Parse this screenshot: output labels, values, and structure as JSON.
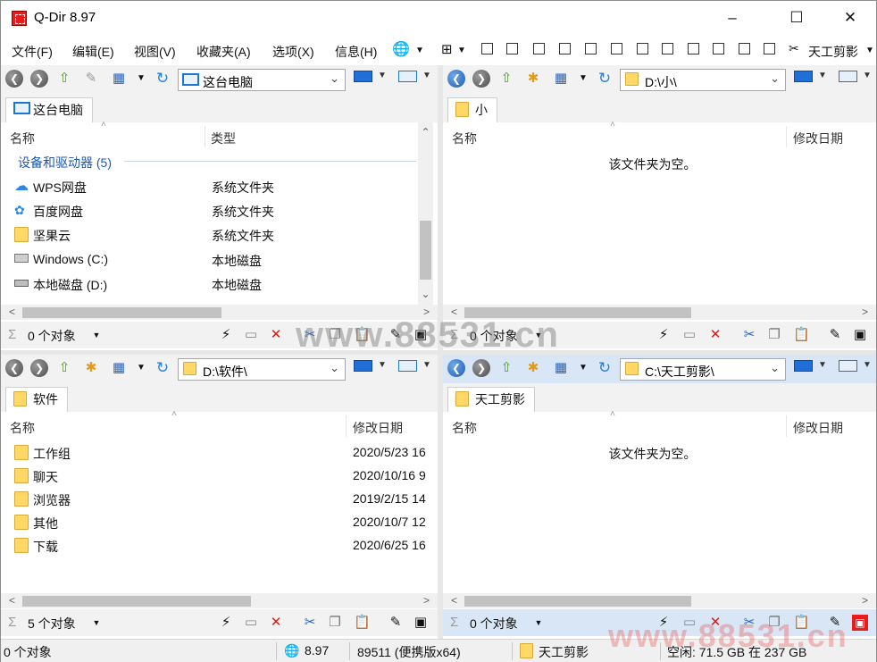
{
  "window": {
    "title": "Q-Dir 8.97"
  },
  "menu": [
    "文件(F)",
    "编辑(E)",
    "视图(V)",
    "收藏夹(A)",
    "选项(X)",
    "信息(H)"
  ],
  "menu_right": {
    "label": "天工剪影"
  },
  "panes": {
    "tl": {
      "address": "这台电脑",
      "tab": "这台电脑",
      "columns": [
        "名称",
        "类型"
      ],
      "group": "设备和驱动器 (5)",
      "rows": [
        {
          "name": "WPS网盘",
          "type": "系统文件夹",
          "icon": "cloud-icon"
        },
        {
          "name": "百度网盘",
          "type": "系统文件夹",
          "icon": "baidu-netdisk-icon"
        },
        {
          "name": "坚果云",
          "type": "系统文件夹",
          "icon": "folder-icon"
        },
        {
          "name": "Windows (C:)",
          "type": "本地磁盘",
          "icon": "windows-drive-icon"
        },
        {
          "name": "本地磁盘 (D:)",
          "type": "本地磁盘",
          "icon": "drive-icon"
        }
      ],
      "status": "0 个对象"
    },
    "tr": {
      "address": "D:\\小\\",
      "tab": "小",
      "columns": [
        "名称",
        "修改日期"
      ],
      "empty": "该文件夹为空。",
      "status": "0 个对象"
    },
    "bl": {
      "address": "D:\\软件\\",
      "tab": "软件",
      "columns": [
        "名称",
        "修改日期"
      ],
      "rows": [
        {
          "name": "工作组",
          "date": "2020/5/23 16"
        },
        {
          "name": "聊天",
          "date": "2020/10/16 9"
        },
        {
          "name": "浏览器",
          "date": "2019/2/15 14"
        },
        {
          "name": "其他",
          "date": "2020/10/7 12"
        },
        {
          "name": "下载",
          "date": "2020/6/25 16"
        }
      ],
      "status": "5 个对象"
    },
    "br": {
      "address": "C:\\天工剪影\\",
      "tab": "天工剪影",
      "columns": [
        "名称",
        "修改日期"
      ],
      "empty": "该文件夹为空。",
      "status": "0 个对象"
    }
  },
  "statusbar": {
    "objects": "0 个对象",
    "version": "8.97",
    "build": "89511 (便携版x64)",
    "folder": "天工剪影",
    "space": "空闲: 71.5 GB 在 237 GB"
  },
  "watermark": "www.88531.cn"
}
